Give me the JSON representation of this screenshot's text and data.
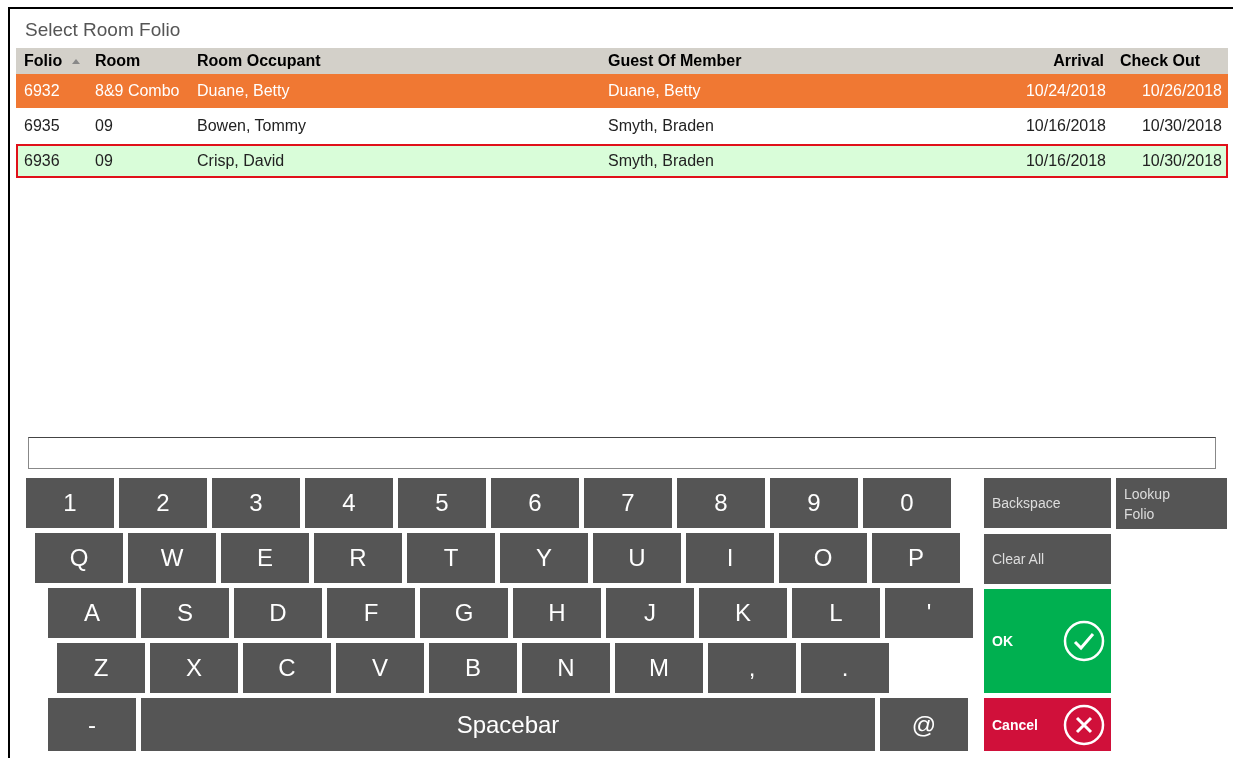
{
  "title": "Select Room Folio",
  "table": {
    "columns": [
      {
        "label": "Folio",
        "sorted": true
      },
      {
        "label": "Room",
        "sorted": false
      },
      {
        "label": "Room Occupant",
        "sorted": false
      },
      {
        "label": "Guest Of Member",
        "sorted": false
      },
      {
        "label": "Arrival",
        "sorted": false
      },
      {
        "label": "Check Out",
        "sorted": false
      }
    ],
    "rows": [
      {
        "cells": [
          "6932",
          "8&9 Combo",
          "Duane, Betty",
          "Duane, Betty",
          "10/24/2018",
          "10/26/2018"
        ],
        "highlighted": true,
        "selected": false
      },
      {
        "cells": [
          "6935",
          "09",
          "Bowen, Tommy",
          "Smyth, Braden",
          "10/16/2018",
          "10/30/2018"
        ],
        "highlighted": false,
        "selected": false
      },
      {
        "cells": [
          "6936",
          "09",
          "Crisp, David",
          "Smyth, Braden",
          "10/16/2018",
          "10/30/2018"
        ],
        "highlighted": false,
        "selected": true
      }
    ]
  },
  "keyboard": {
    "rows": [
      [
        "1",
        "2",
        "3",
        "4",
        "5",
        "6",
        "7",
        "8",
        "9",
        "0"
      ],
      [
        "Q",
        "W",
        "E",
        "R",
        "T",
        "Y",
        "U",
        "I",
        "O",
        "P"
      ],
      [
        "A",
        "S",
        "D",
        "F",
        "G",
        "H",
        "J",
        "K",
        "L",
        "'"
      ],
      [
        "Z",
        "X",
        "C",
        "V",
        "B",
        "N",
        "M",
        ",",
        "."
      ]
    ],
    "bottom_keys": [
      {
        "label": "-",
        "kind": "key"
      },
      {
        "label": "Spacebar",
        "kind": "space"
      },
      {
        "label": "@",
        "kind": "key"
      }
    ]
  },
  "side_buttons": [
    {
      "label": "Backspace",
      "kind": "function"
    },
    {
      "label": "Lookup Folio",
      "kind": "function"
    },
    {
      "label": "Clear All",
      "kind": "function"
    },
    {
      "label": "OK",
      "kind": "ok"
    },
    {
      "label": "Cancel",
      "kind": "cancel"
    }
  ]
}
